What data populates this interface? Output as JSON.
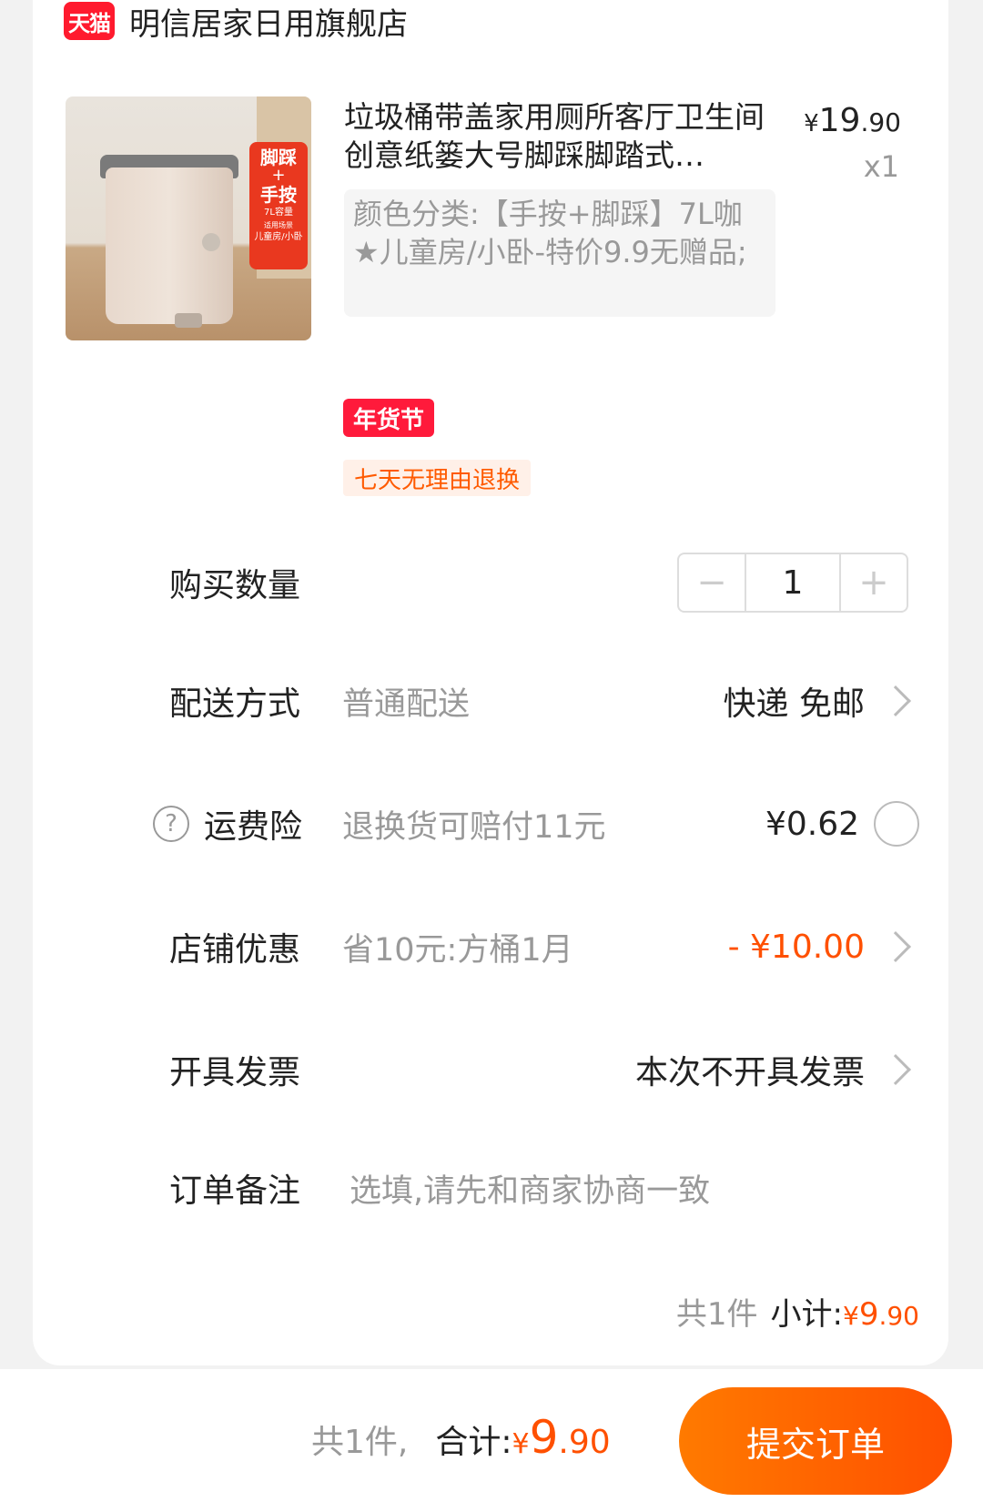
{
  "store": {
    "badge": "天猫",
    "name": "明信居家日用旗舰店"
  },
  "product": {
    "image_badge": {
      "line1": "脚踩",
      "line2": "+",
      "line3": "手按",
      "line4": "7L容量",
      "line5": "适用场景",
      "line6": "儿童房/小卧"
    },
    "title": "垃圾桶带盖家用厕所客厅卫生间创意纸篓大号脚踩脚踏式…",
    "price_symbol": "¥",
    "price_int": "19",
    "price_dec": ".90",
    "quantity": "x1",
    "sku": "颜色分类:【手按+脚踩】7L咖★儿童房/小卧-特价9.9无赠品;",
    "tag_festival": "年货节",
    "tag_return": "七天无理由退换"
  },
  "quantity_row": {
    "label": "购买数量",
    "minus": "−",
    "value": "1",
    "plus": "+"
  },
  "delivery_row": {
    "label": "配送方式",
    "desc": "普通配送",
    "value": "快递 免邮"
  },
  "insurance_row": {
    "help": "?",
    "label": "运费险",
    "desc": "退换货可赔付11元",
    "value": "¥0.62"
  },
  "discount_row": {
    "label": "店铺优惠",
    "desc": "省10元:方桶1月",
    "value": "- ¥10.00"
  },
  "invoice_row": {
    "label": "开具发票",
    "value": "本次不开具发票"
  },
  "note_row": {
    "label": "订单备注",
    "placeholder": "选填,请先和商家协商一致"
  },
  "subtotal": {
    "count": "共1件",
    "label": "小计:",
    "symbol": "¥",
    "int": "9",
    "dec": ".90"
  },
  "bottom": {
    "count": "共1件,",
    "label": "合计:",
    "symbol": "¥",
    "int": "9",
    "dec": ".90",
    "submit": "提交订单"
  },
  "colors": {
    "accent": "#ff5000",
    "tmall_red": "#ff1a2e"
  }
}
